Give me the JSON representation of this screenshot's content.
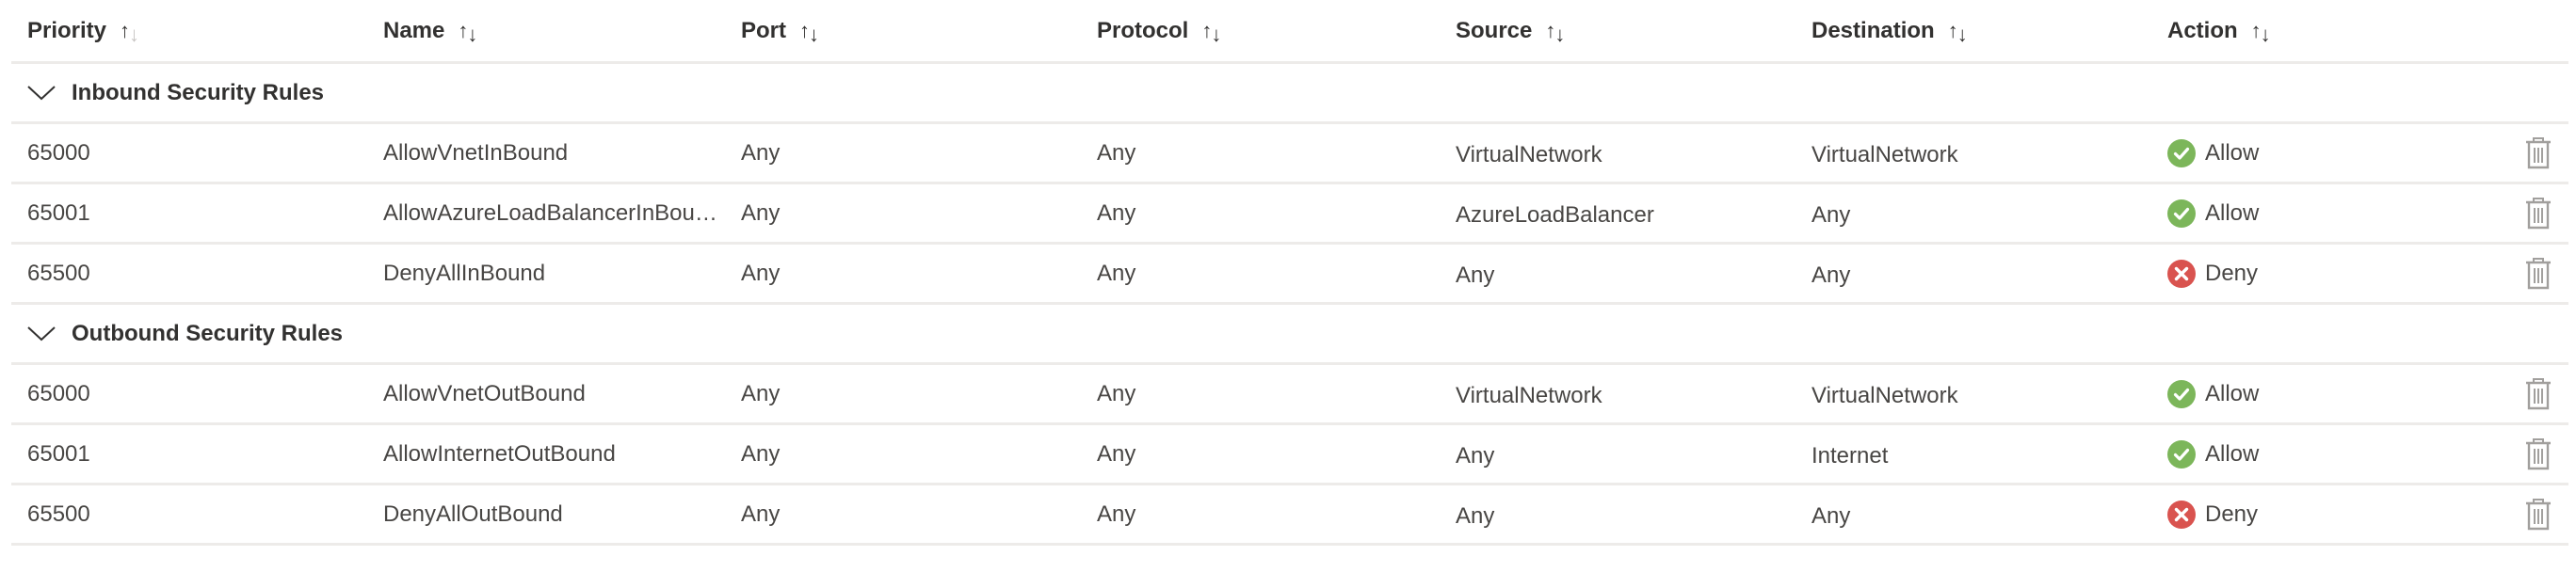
{
  "columns": [
    {
      "label": "Priority",
      "sort": "asc"
    },
    {
      "label": "Name",
      "sort": "none"
    },
    {
      "label": "Port",
      "sort": "none"
    },
    {
      "label": "Protocol",
      "sort": "none"
    },
    {
      "label": "Source",
      "sort": "none"
    },
    {
      "label": "Destination",
      "sort": "none"
    },
    {
      "label": "Action",
      "sort": "none"
    }
  ],
  "sort_icons": {
    "up": "↑",
    "down": "↓"
  },
  "colors": {
    "allow": "#7cb65a",
    "deny": "#d9534f",
    "separator": "#edebe9",
    "icon_gray": "#a19f9d"
  },
  "groups": [
    {
      "title": "Inbound Security Rules",
      "expanded": true,
      "rules": [
        {
          "priority": "65000",
          "name": "AllowVnetInBound",
          "port": "Any",
          "protocol": "Any",
          "source": "VirtualNetwork",
          "destination": "VirtualNetwork",
          "action": "Allow"
        },
        {
          "priority": "65001",
          "name": "AllowAzureLoadBalancerInBound",
          "port": "Any",
          "protocol": "Any",
          "source": "AzureLoadBalancer",
          "destination": "Any",
          "action": "Allow"
        },
        {
          "priority": "65500",
          "name": "DenyAllInBound",
          "port": "Any",
          "protocol": "Any",
          "source": "Any",
          "destination": "Any",
          "action": "Deny"
        }
      ]
    },
    {
      "title": "Outbound Security Rules",
      "expanded": true,
      "rules": [
        {
          "priority": "65000",
          "name": "AllowVnetOutBound",
          "port": "Any",
          "protocol": "Any",
          "source": "VirtualNetwork",
          "destination": "VirtualNetwork",
          "action": "Allow"
        },
        {
          "priority": "65001",
          "name": "AllowInternetOutBound",
          "port": "Any",
          "protocol": "Any",
          "source": "Any",
          "destination": "Internet",
          "action": "Allow"
        },
        {
          "priority": "65500",
          "name": "DenyAllOutBound",
          "port": "Any",
          "protocol": "Any",
          "source": "Any",
          "destination": "Any",
          "action": "Deny"
        }
      ]
    }
  ]
}
